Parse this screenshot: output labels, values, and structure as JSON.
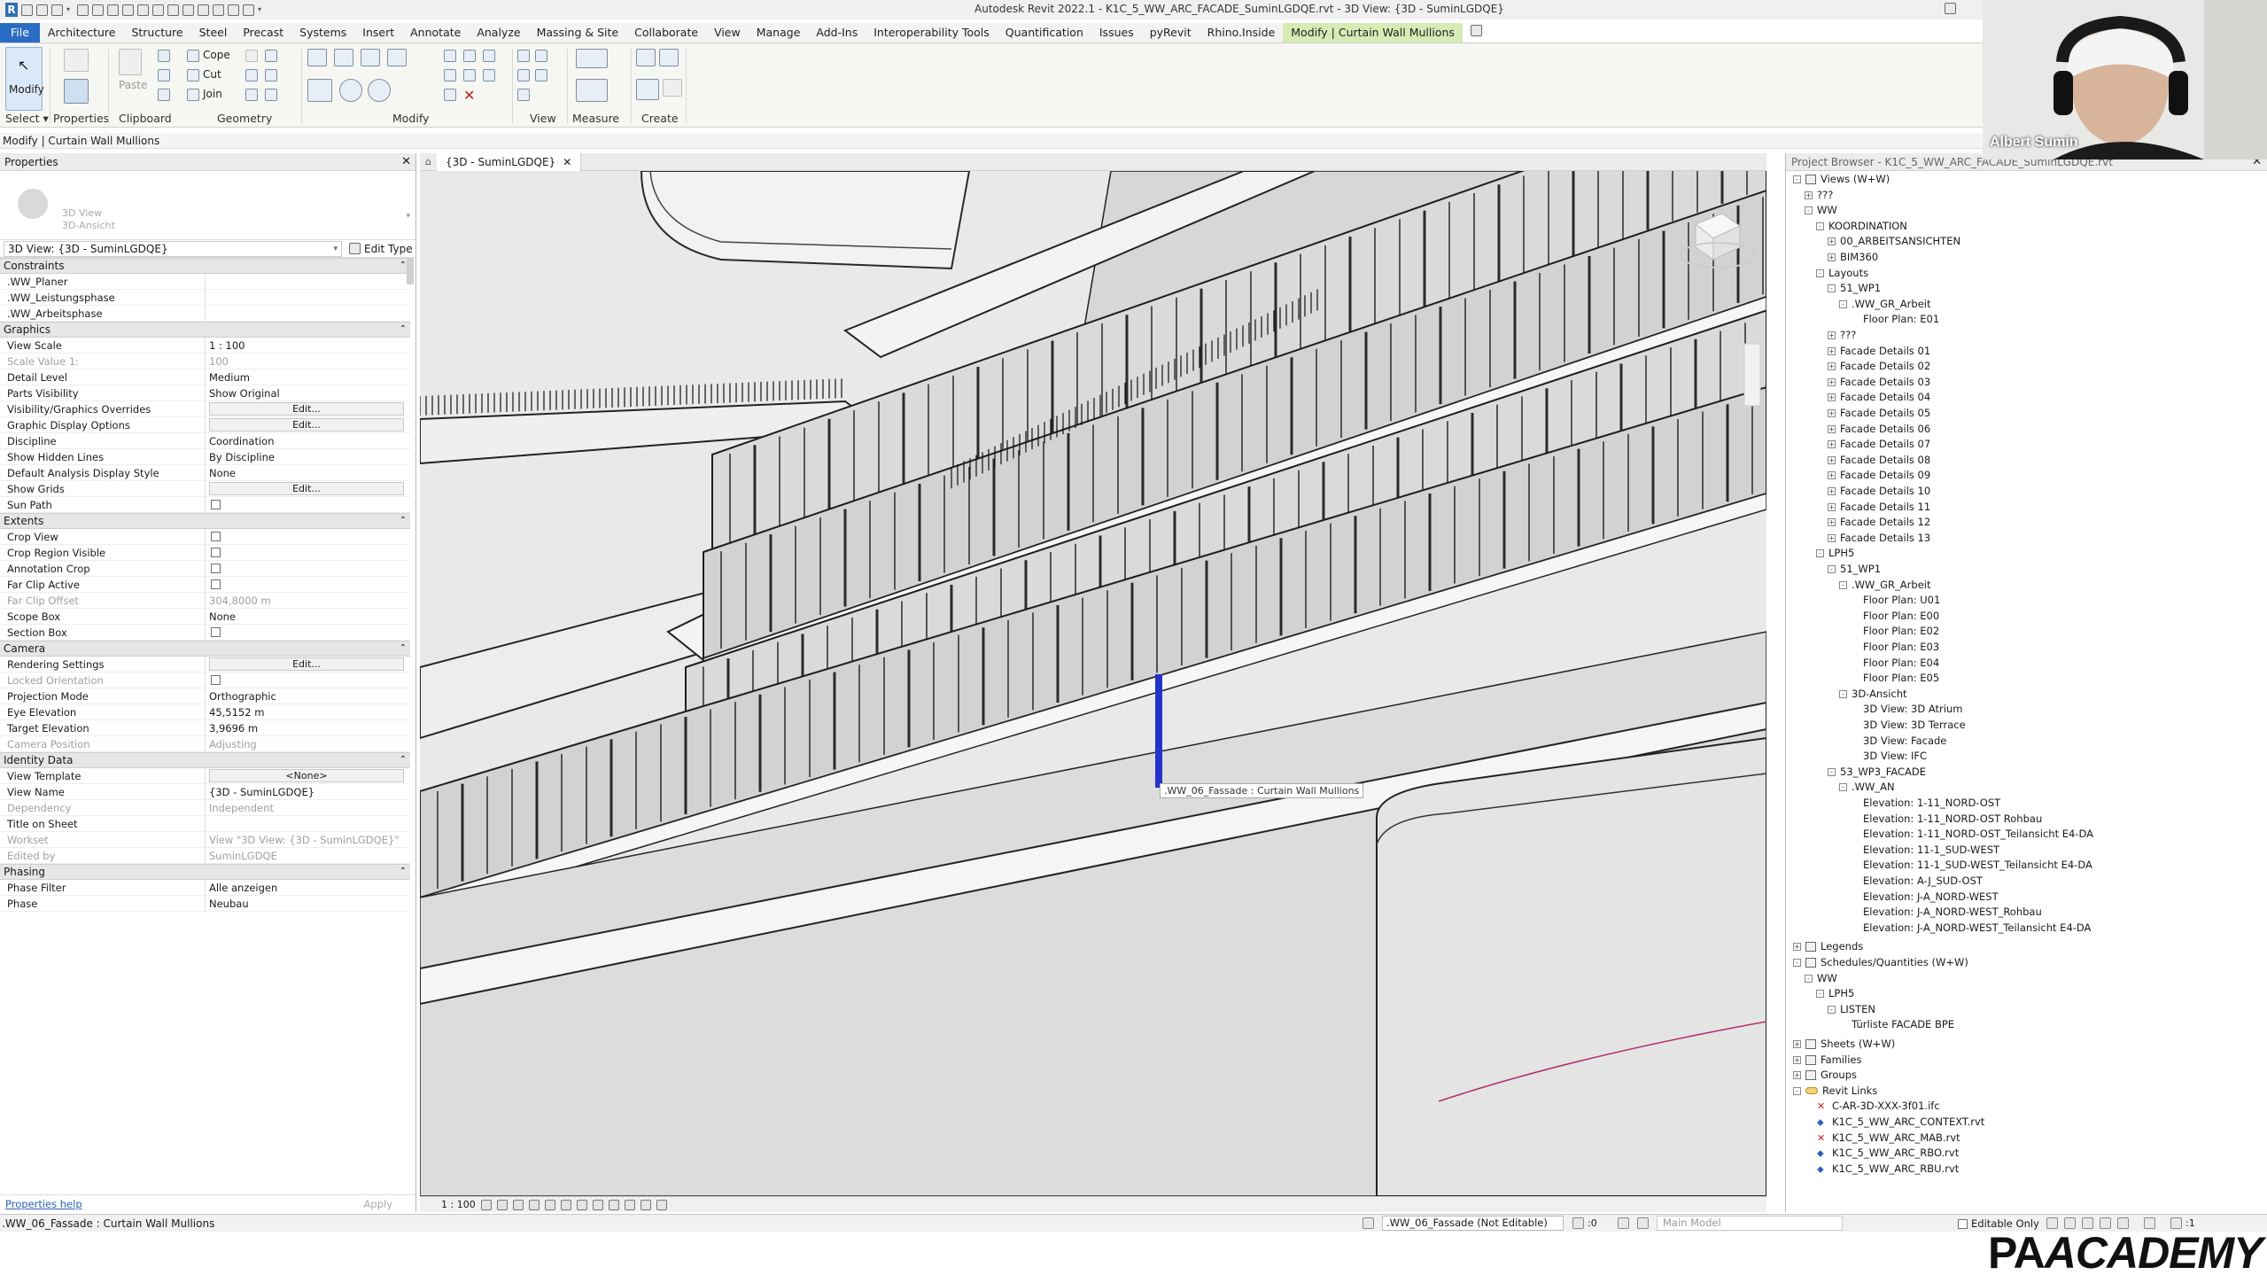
{
  "window": {
    "title": "Autodesk Revit 2022.1 - K1C_5_WW_ARC_FACADE_SuminLGDQE.rvt - 3D View: {3D - SuminLGDQE}"
  },
  "ribbon": {
    "tabs": [
      "File",
      "Architecture",
      "Structure",
      "Steel",
      "Precast",
      "Systems",
      "Insert",
      "Annotate",
      "Analyze",
      "Massing & Site",
      "Collaborate",
      "View",
      "Manage",
      "Add-Ins",
      "Interoperability Tools",
      "Quantification",
      "Issues",
      "pyRevit",
      "Rhino.Inside",
      "Modify | Curtain Wall Mullions"
    ],
    "modify_label": "Modify",
    "select_label": "Select",
    "properties_label": "Properties",
    "paste_label": "Paste",
    "cope_label": "Cope",
    "cut_label": "Cut",
    "join_label": "Join",
    "panels": {
      "clipboard": "Clipboard",
      "geometry": "Geometry",
      "modify": "Modify",
      "view": "View",
      "measure": "Measure",
      "create": "Create"
    }
  },
  "options_bar": {
    "context": "Modify | Curtain Wall Mullions"
  },
  "properties": {
    "header": "Properties",
    "type_name_line1": "3D View",
    "type_name_line2": "3D-Ansicht",
    "instance_selector": "3D View: {3D - SuminLGDQE}",
    "edit_type": "Edit Type",
    "groups": [
      {
        "name": "Constraints",
        "rows": [
          {
            "name": ".WW_Planer",
            "value": ""
          },
          {
            "name": ".WW_Leistungsphase",
            "value": ""
          },
          {
            "name": ".WW_Arbeitsphase",
            "value": ""
          }
        ]
      },
      {
        "name": "Graphics",
        "rows": [
          {
            "name": "View Scale",
            "value": "1 : 100"
          },
          {
            "name": "Scale Value    1:",
            "value": "100",
            "dim": true
          },
          {
            "name": "Detail Level",
            "value": "Medium"
          },
          {
            "name": "Parts Visibility",
            "value": "Show Original"
          },
          {
            "name": "Visibility/Graphics Overrides",
            "button": "Edit..."
          },
          {
            "name": "Graphic Display Options",
            "button": "Edit..."
          },
          {
            "name": "Discipline",
            "value": "Coordination"
          },
          {
            "name": "Show Hidden Lines",
            "value": "By Discipline"
          },
          {
            "name": "Default Analysis Display Style",
            "value": "None"
          },
          {
            "name": "Show Grids",
            "button": "Edit..."
          },
          {
            "name": "Sun Path",
            "checkbox": true
          }
        ]
      },
      {
        "name": "Extents",
        "rows": [
          {
            "name": "Crop View",
            "checkbox": true
          },
          {
            "name": "Crop Region Visible",
            "checkbox": true
          },
          {
            "name": "Annotation Crop",
            "checkbox": true
          },
          {
            "name": "Far Clip Active",
            "checkbox": true
          },
          {
            "name": "Far Clip Offset",
            "value": "304,8000 m",
            "dim": true
          },
          {
            "name": "Scope Box",
            "value": "None"
          },
          {
            "name": "Section Box",
            "checkbox": true
          }
        ]
      },
      {
        "name": "Camera",
        "rows": [
          {
            "name": "Rendering Settings",
            "button": "Edit..."
          },
          {
            "name": "Locked Orientation",
            "checkbox": true,
            "dim": true
          },
          {
            "name": "Projection Mode",
            "value": "Orthographic"
          },
          {
            "name": "Eye Elevation",
            "value": "45,5152 m"
          },
          {
            "name": "Target Elevation",
            "value": "3,9696 m"
          },
          {
            "name": "Camera Position",
            "value": "Adjusting",
            "dim": true
          }
        ]
      },
      {
        "name": "Identity Data",
        "rows": [
          {
            "name": "View Template",
            "button": "<None>"
          },
          {
            "name": "View Name",
            "value": "{3D - SuminLGDQE}"
          },
          {
            "name": "Dependency",
            "value": "Independent",
            "dim": true
          },
          {
            "name": "Title on Sheet",
            "value": ""
          },
          {
            "name": "Workset",
            "value": "View \"3D View: {3D - SuminLGDQE}\"",
            "dim": true
          },
          {
            "name": "Edited by",
            "value": "SuminLGDQE",
            "dim": true
          }
        ]
      },
      {
        "name": "Phasing",
        "rows": [
          {
            "name": "Phase Filter",
            "value": "Alle anzeigen"
          },
          {
            "name": "Phase",
            "value": "Neubau"
          }
        ]
      }
    ],
    "help_link": "Properties help",
    "apply": "Apply"
  },
  "view": {
    "tab_title": "{3D - SuminLGDQE}",
    "tooltip": ".WW_06_Fassade : Curtain Wall Mullions",
    "scale": "1 : 100"
  },
  "browser": {
    "header": "Project Browser - K1C_5_WW_ARC_FACADE_SuminLGDQE.rvt",
    "items": [
      {
        "label": "Views (W+W)",
        "level": 0,
        "toggle": "-",
        "icon": "views"
      },
      {
        "label": "???",
        "level": 1,
        "toggle": "+"
      },
      {
        "label": "WW",
        "level": 1,
        "toggle": "-"
      },
      {
        "label": "KOORDINATION",
        "level": 2,
        "toggle": "-"
      },
      {
        "label": "00_ARBEITSANSICHTEN",
        "level": 3,
        "toggle": "+"
      },
      {
        "label": "BIM360",
        "level": 3,
        "toggle": "+"
      },
      {
        "label": "Layouts",
        "level": 2,
        "toggle": "-"
      },
      {
        "label": "51_WP1",
        "level": 3,
        "toggle": "-"
      },
      {
        "label": ".WW_GR_Arbeit",
        "level": 4,
        "toggle": "-"
      },
      {
        "label": "Floor Plan: E01",
        "level": 5
      },
      {
        "label": "???",
        "level": 3,
        "toggle": "+"
      },
      {
        "label": "Facade Details 01",
        "level": 3,
        "toggle": "+"
      },
      {
        "label": "Facade Details 02",
        "level": 3,
        "toggle": "+"
      },
      {
        "label": "Facade Details 03",
        "level": 3,
        "toggle": "+"
      },
      {
        "label": "Facade Details 04",
        "level": 3,
        "toggle": "+"
      },
      {
        "label": "Facade Details 05",
        "level": 3,
        "toggle": "+"
      },
      {
        "label": "Facade Details 06",
        "level": 3,
        "toggle": "+"
      },
      {
        "label": "Facade Details 07",
        "level": 3,
        "toggle": "+"
      },
      {
        "label": "Facade Details 08",
        "level": 3,
        "toggle": "+"
      },
      {
        "label": "Facade Details 09",
        "level": 3,
        "toggle": "+"
      },
      {
        "label": "Facade Details 10",
        "level": 3,
        "toggle": "+"
      },
      {
        "label": "Facade Details 11",
        "level": 3,
        "toggle": "+"
      },
      {
        "label": "Facade Details 12",
        "level": 3,
        "toggle": "+"
      },
      {
        "label": "Facade Details 13",
        "level": 3,
        "toggle": "+"
      },
      {
        "label": "LPH5",
        "level": 2,
        "toggle": "-"
      },
      {
        "label": "51_WP1",
        "level": 3,
        "toggle": "-"
      },
      {
        "label": ".WW_GR_Arbeit",
        "level": 4,
        "toggle": "-"
      },
      {
        "label": "Floor Plan: U01",
        "level": 5
      },
      {
        "label": "Floor Plan: E00",
        "level": 5
      },
      {
        "label": "Floor Plan: E02",
        "level": 5
      },
      {
        "label": "Floor Plan: E03",
        "level": 5
      },
      {
        "label": "Floor Plan: E04",
        "level": 5
      },
      {
        "label": "Floor Plan: E05",
        "level": 5
      },
      {
        "label": "3D-Ansicht",
        "level": 4,
        "toggle": "-"
      },
      {
        "label": "3D View: 3D Atrium",
        "level": 5
      },
      {
        "label": "3D View: 3D Terrace",
        "level": 5
      },
      {
        "label": "3D View: Facade",
        "level": 5
      },
      {
        "label": "3D View: IFC",
        "level": 5
      },
      {
        "label": "53_WP3_FACADE",
        "level": 3,
        "toggle": "-"
      },
      {
        "label": ".WW_AN",
        "level": 4,
        "toggle": "-"
      },
      {
        "label": "Elevation: 1-11_NORD-OST",
        "level": 5
      },
      {
        "label": "Elevation: 1-11_NORD-OST Rohbau",
        "level": 5
      },
      {
        "label": "Elevation: 1-11_NORD-OST_Teilansicht E4-DA",
        "level": 5
      },
      {
        "label": "Elevation: 11-1_SUD-WEST",
        "level": 5
      },
      {
        "label": "Elevation: 11-1_SUD-WEST_Teilansicht E4-DA",
        "level": 5
      },
      {
        "label": "Elevation: A-J_SUD-OST",
        "level": 5
      },
      {
        "label": "Elevation: J-A_NORD-WEST",
        "level": 5
      },
      {
        "label": "Elevation: J-A_NORD-WEST_Rohbau",
        "level": 5
      },
      {
        "label": "Elevation: J-A_NORD-WEST_Teilansicht E4-DA",
        "level": 5
      },
      {
        "label": "",
        "level": 0,
        "spacer": true
      },
      {
        "label": "Legends",
        "level": 0,
        "toggle": "+",
        "icon": "legend"
      },
      {
        "label": "Schedules/Quantities (W+W)",
        "level": 0,
        "toggle": "-",
        "icon": "schedule"
      },
      {
        "label": "WW",
        "level": 1,
        "toggle": "-"
      },
      {
        "label": "LPH5",
        "level": 2,
        "toggle": "-"
      },
      {
        "label": "LISTEN",
        "level": 3,
        "toggle": "-"
      },
      {
        "label": "Türliste FACADE BPE",
        "level": 4
      },
      {
        "label": "",
        "level": 0,
        "spacer": true
      },
      {
        "label": "Sheets (W+W)",
        "level": 0,
        "toggle": "+",
        "icon": "sheet"
      },
      {
        "label": "Families",
        "level": 0,
        "toggle": "+",
        "icon": "family"
      },
      {
        "label": "Groups",
        "level": 0,
        "toggle": "+",
        "icon": "group"
      },
      {
        "label": "Revit Links",
        "level": 0,
        "toggle": "-",
        "icon": "links"
      },
      {
        "label": "C-AR-3D-XXX-3f01.ifc",
        "level": 1,
        "icon": "err"
      },
      {
        "label": "K1C_5_WW_ARC_CONTEXT.rvt",
        "level": 1,
        "icon": "link"
      },
      {
        "label": "K1C_5_WW_ARC_MAB.rvt",
        "level": 1,
        "icon": "err"
      },
      {
        "label": "K1C_5_WW_ARC_RBO.rvt",
        "level": 1,
        "icon": "link"
      },
      {
        "label": "K1C_5_WW_ARC_RBU.rvt",
        "level": 1,
        "icon": "link"
      }
    ]
  },
  "status": {
    "text": ".WW_06_Fassade : Curtain Wall Mullions",
    "workset": ".WW_06_Fassade (Not Editable)",
    "workset_count": ":0",
    "design_option": "Main Model",
    "editable_only": "Editable Only",
    "filter_count": ":1"
  },
  "webcam": {
    "name": "Albert Sumin"
  },
  "logo": {
    "part1": "PA",
    "part2": "ACADEMY"
  },
  "colors": {
    "file_tab": "#2b6cc4",
    "context_tab": "#d7ebb5",
    "selection": "#2233cc",
    "link": "#2a62b8"
  }
}
